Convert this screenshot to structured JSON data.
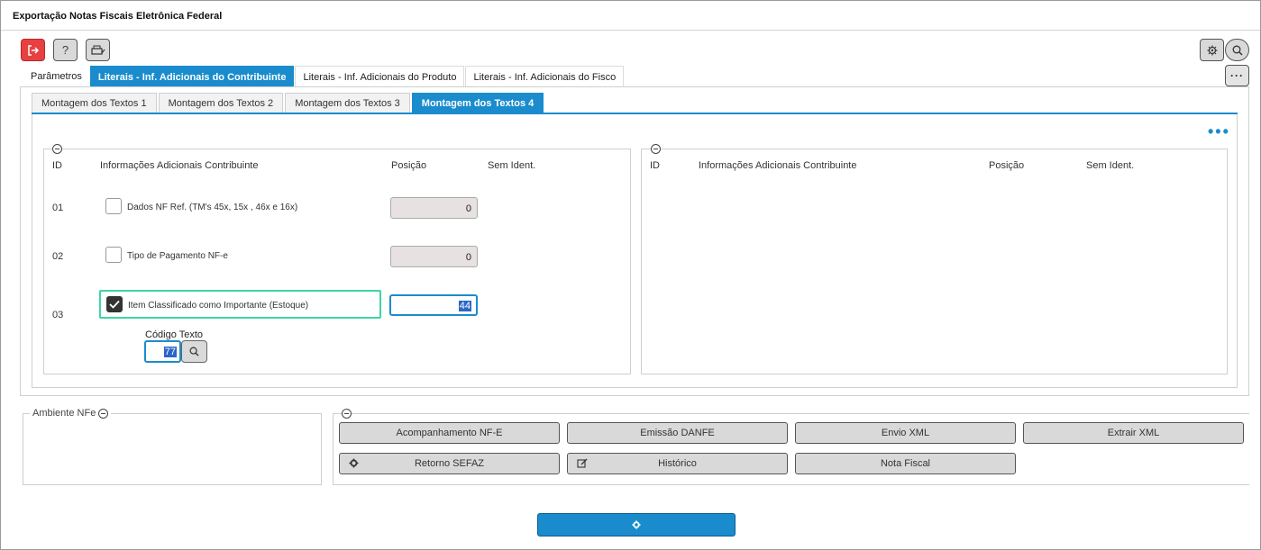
{
  "window": {
    "title": "Exportação Notas Fiscais Eletrônica Federal"
  },
  "toolbar": {
    "exit_icon": "exit-icon",
    "help_label": "?",
    "print_icon": "printer-icon",
    "settings_icon": "gear-icon",
    "search_icon": "search-icon",
    "more_label": "···"
  },
  "tabs": [
    {
      "label": "Parâmetros",
      "active": false
    },
    {
      "label": "Literais - Inf. Adicionais do Contribuinte",
      "active": true
    },
    {
      "label": "Literais - Inf. Adicionais do Produto",
      "active": false
    },
    {
      "label": "Literais - Inf. Adicionais do Fisco",
      "active": false
    }
  ],
  "subtabs": [
    {
      "label": "Montagem dos Textos 1",
      "active": false
    },
    {
      "label": "Montagem dos Textos 2",
      "active": false
    },
    {
      "label": "Montagem dos Textos 3",
      "active": false
    },
    {
      "label": "Montagem dos Textos 4",
      "active": true
    }
  ],
  "left_group": {
    "headers": {
      "id": "ID",
      "info": "Informações Adicionais Contribuinte",
      "pos": "Posição",
      "sem": "Sem Ident."
    },
    "rows": [
      {
        "id": "01",
        "label": "Dados NF Ref. (TM's 45x, 15x , 46x e 16x)",
        "checked": false,
        "position": "0"
      },
      {
        "id": "02",
        "label": "Tipo de Pagamento NF-e",
        "checked": false,
        "position": "0"
      },
      {
        "id": "03",
        "label": "Item Classificado como Importante (Estoque)",
        "checked": true,
        "position": "44"
      }
    ],
    "code_text": {
      "label": "Código Texto",
      "value": "77"
    }
  },
  "right_group": {
    "headers": {
      "id": "ID",
      "info": "Informações Adicionais Contribuinte",
      "pos": "Posição",
      "sem": "Sem Ident."
    }
  },
  "ambiente": {
    "label": "Ambiente NFe"
  },
  "actions": {
    "acompanhamento": "Acompanhamento NF-E",
    "emissao": "Emissão DANFE",
    "envio": "Envio XML",
    "extrair": "Extrair XML",
    "retorno": "Retorno SEFAZ",
    "historico": "Histórico",
    "nota": "Nota Fiscal"
  },
  "colors": {
    "accent": "#1a8ccd",
    "danger": "#e84040",
    "focus_outline": "#3fd6a3"
  }
}
